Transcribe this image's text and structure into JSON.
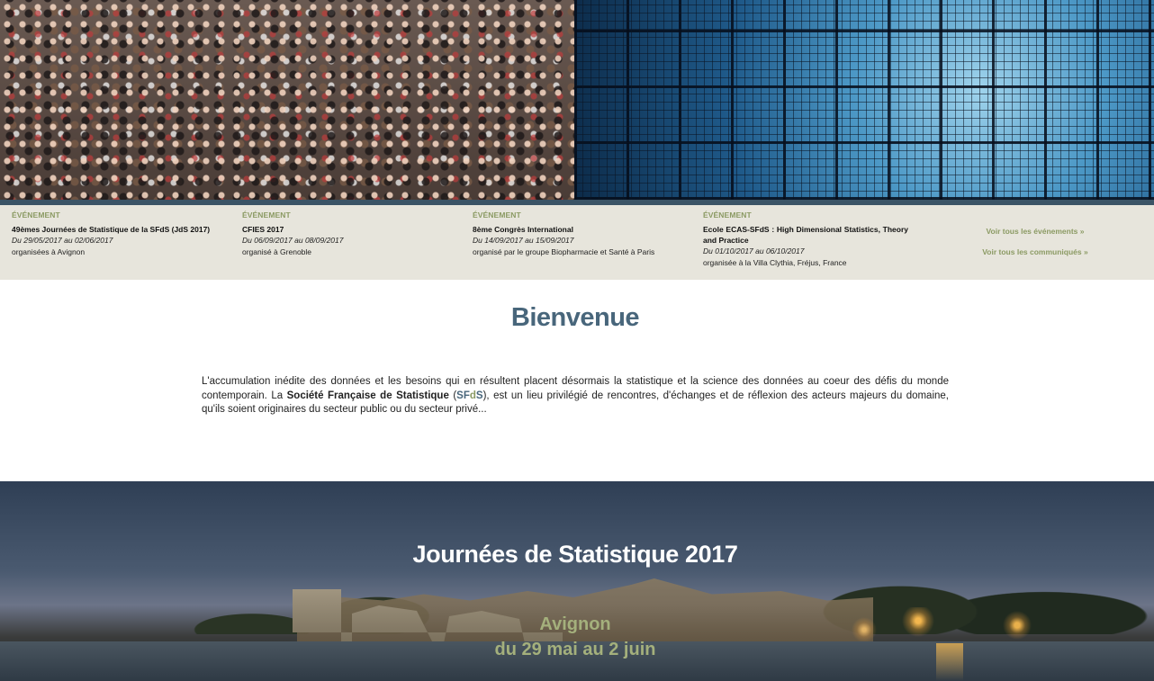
{
  "events": [
    {
      "kicker": "Événement",
      "title": "49èmes Journées de Statistique de la SFdS (JdS 2017)",
      "date": "Du 29/05/2017 au 02/06/2017",
      "place": "organisées à Avignon"
    },
    {
      "kicker": "Événement",
      "title": "CFIES 2017",
      "date": "Du 06/09/2017 au 08/09/2017",
      "place": "organisé à Grenoble"
    },
    {
      "kicker": "Événement",
      "title": "8ème Congrès International",
      "date": "Du 14/09/2017 au 15/09/2017",
      "place": "organisé par le groupe Biopharmacie et Santé à Paris"
    },
    {
      "kicker": "Événement",
      "title": "Ecole ECAS-SFdS : High Dimensional Statistics, Theory and Practice",
      "date": "Du 01/10/2017 au 06/10/2017",
      "place": "organisée à la Villa Clythia, Fréjus, France"
    }
  ],
  "links": {
    "all_events": "Voir tous les événements »",
    "all_press": "Voir tous les communiqués »"
  },
  "welcome": {
    "title": "Bienvenue",
    "text_part1": "L'accumulation inédite des données et les besoins qui en résultent placent désormais la statistique et la science des données au coeur des défis du monde contemporain. La ",
    "society_name": "Société Française de Statistique",
    "text_part2": " (",
    "abbr_s": "S",
    "abbr_f": "F",
    "abbr_d": "d",
    "abbr_s2": "S",
    "text_part3": "), est un lieu privilégié de rencontres, d'échanges et de réflexion des acteurs majeurs du domaine, qu'ils soient originaires du secteur public ou du secteur privé..."
  },
  "jds": {
    "title": "Journées de Statistique 2017",
    "city": "Avignon",
    "dates": "du 29 mai au 2 juin"
  },
  "colors": {
    "accent_blue": "#48667b",
    "accent_green": "#8b9a63",
    "strip_bg": "#e7e5dc"
  }
}
